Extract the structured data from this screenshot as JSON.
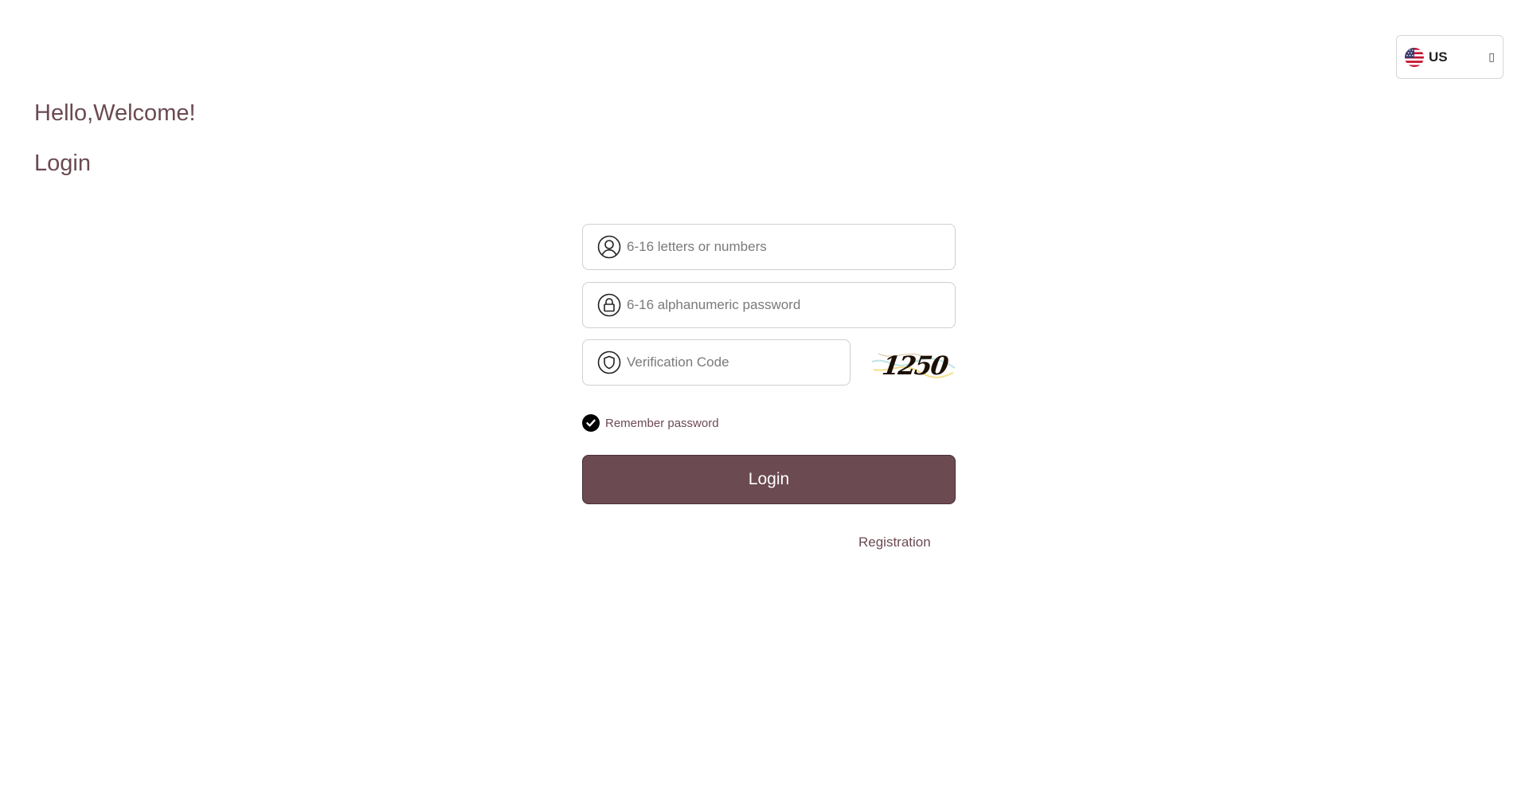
{
  "language": {
    "code": "US",
    "flag_icon": "us-flag-icon",
    "caret_icon": "chevron-down-icon"
  },
  "header": {
    "greeting": "Hello,Welcome!",
    "title": "Login"
  },
  "form": {
    "username": {
      "placeholder": "6-16 letters or numbers",
      "value": "",
      "icon": "user-icon"
    },
    "password": {
      "placeholder": "6-16 alphanumeric password",
      "value": "",
      "icon": "lock-icon"
    },
    "verification": {
      "placeholder": "Verification Code",
      "value": "",
      "icon": "shield-icon",
      "captcha_text": "1250"
    },
    "remember": {
      "label": "Remember password",
      "checked": true
    },
    "login_label": "Login",
    "register_label": "Registration"
  },
  "colors": {
    "accent": "#6b4a52",
    "text": "#6b4a52",
    "button_border": "#4a2f36"
  }
}
